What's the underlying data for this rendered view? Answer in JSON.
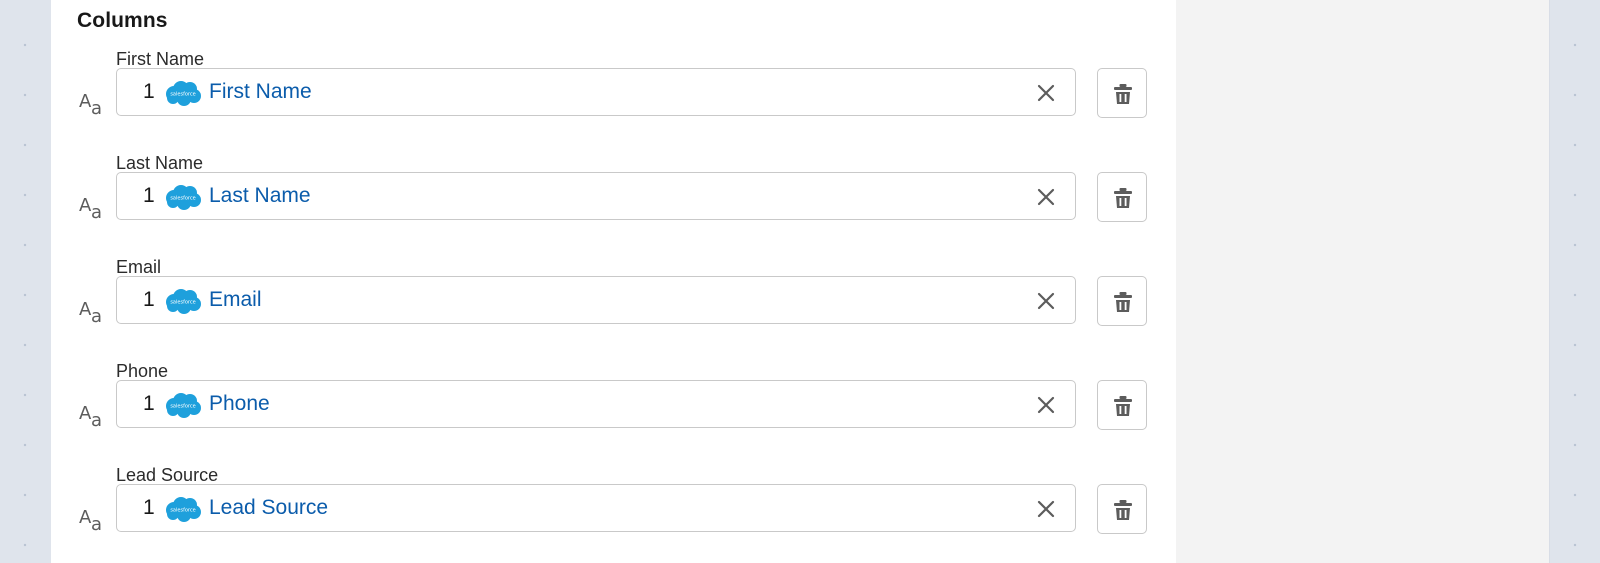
{
  "section": {
    "title": "Columns"
  },
  "type_icon": {
    "big": "A",
    "small": "a"
  },
  "colors": {
    "value_text": "#0b5cab",
    "salesforce_cloud": "#1ea0dc",
    "icon_gray": "#5c5c5c"
  },
  "columns": [
    {
      "label": "First Name",
      "prefix": "1",
      "value": "First Name",
      "source_icon": "salesforce-cloud-icon"
    },
    {
      "label": "Last Name",
      "prefix": "1",
      "value": "Last Name",
      "source_icon": "salesforce-cloud-icon"
    },
    {
      "label": "Email",
      "prefix": "1",
      "value": "Email",
      "source_icon": "salesforce-cloud-icon"
    },
    {
      "label": "Phone",
      "prefix": "1",
      "value": "Phone",
      "source_icon": "salesforce-cloud-icon"
    },
    {
      "label": "Lead Source",
      "prefix": "1",
      "value": "Lead Source",
      "source_icon": "salesforce-cloud-icon"
    }
  ],
  "sf_logo_text": "salesforce"
}
